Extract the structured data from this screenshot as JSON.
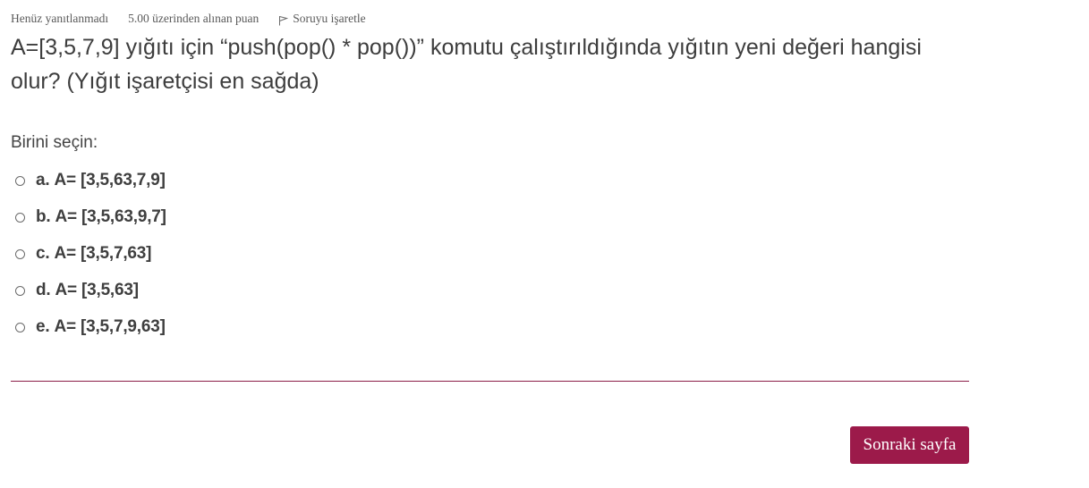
{
  "info": {
    "state": "Henüz yanıtlanmadı",
    "grade": "5.00 üzerinden alınan puan",
    "flag_label": "Soruyu işaretle"
  },
  "question": {
    "text": "A=[3,5,7,9] yığıtı için “push(pop() * pop())” komutu çalıştırıldığında yığıtın yeni değeri hangisi olur? (Yığıt işaretçisi en sağda)",
    "prompt": "Birini seçin:"
  },
  "answers": [
    {
      "letter": "a.",
      "text": "A= [3,5,63,7,9]",
      "selected": false
    },
    {
      "letter": "b.",
      "text": "A= [3,5,63,9,7]",
      "selected": false
    },
    {
      "letter": "c.",
      "text": "A= [3,5,7,63]",
      "selected": false
    },
    {
      "letter": "d.",
      "text": "A= [3,5,63]",
      "selected": false
    },
    {
      "letter": "e.",
      "text": "A= [3,5,7,9,63]",
      "selected": false
    }
  ],
  "navigation": {
    "next_label": "Sonraki sayfa"
  },
  "colors": {
    "accent": "#9c1a4a",
    "divider": "#8a1d47",
    "text": "#444444"
  },
  "icons": {
    "flag": "flag-icon"
  }
}
